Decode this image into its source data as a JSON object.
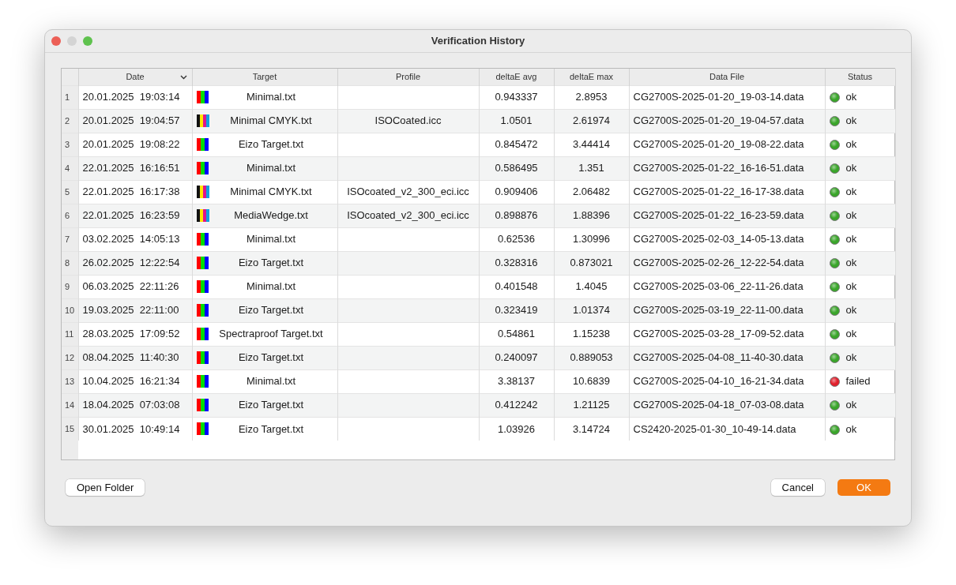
{
  "window": {
    "title": "Verification History"
  },
  "table": {
    "columns": [
      {
        "label": "Date",
        "sorted": true
      },
      {
        "label": "Target",
        "sorted": false
      },
      {
        "label": "Profile",
        "sorted": false
      },
      {
        "label": "deltaE avg",
        "sorted": false
      },
      {
        "label": "deltaE max",
        "sorted": false
      },
      {
        "label": "Data File",
        "sorted": false
      },
      {
        "label": "Status",
        "sorted": false
      }
    ],
    "rows": [
      {
        "index": "1",
        "date": "20.01.2025  19:03:14",
        "kind": "rgb",
        "target": "Minimal.txt",
        "profile": "",
        "avg": "0.943337",
        "max": "2.8953",
        "file": "CG2700S-2025-01-20_19-03-14.data",
        "color": "#3aa52a",
        "status": "ok"
      },
      {
        "index": "2",
        "date": "20.01.2025  19:04:57",
        "kind": "cmyk",
        "target": "Minimal CMYK.txt",
        "profile": "ISOCoated.icc",
        "avg": "1.0501",
        "max": "2.61974",
        "file": "CG2700S-2025-01-20_19-04-57.data",
        "color": "#3aa52a",
        "status": "ok"
      },
      {
        "index": "3",
        "date": "20.01.2025  19:08:22",
        "kind": "rgb",
        "target": "Eizo Target.txt",
        "profile": "",
        "avg": "0.845472",
        "max": "3.44414",
        "file": "CG2700S-2025-01-20_19-08-22.data",
        "color": "#3aa52a",
        "status": "ok"
      },
      {
        "index": "4",
        "date": "22.01.2025  16:16:51",
        "kind": "rgb",
        "target": "Minimal.txt",
        "profile": "",
        "avg": "0.586495",
        "max": "1.351",
        "file": "CG2700S-2025-01-22_16-16-51.data",
        "color": "#3aa52a",
        "status": "ok"
      },
      {
        "index": "5",
        "date": "22.01.2025  16:17:38",
        "kind": "cmyk",
        "target": "Minimal CMYK.txt",
        "profile": "ISOcoated_v2_300_eci.icc",
        "avg": "0.909406",
        "max": "2.06482",
        "file": "CG2700S-2025-01-22_16-17-38.data",
        "color": "#3aa52a",
        "status": "ok"
      },
      {
        "index": "6",
        "date": "22.01.2025  16:23:59",
        "kind": "cmyk",
        "target": "MediaWedge.txt",
        "profile": "ISOcoated_v2_300_eci.icc",
        "avg": "0.898876",
        "max": "1.88396",
        "file": "CG2700S-2025-01-22_16-23-59.data",
        "color": "#3aa52a",
        "status": "ok"
      },
      {
        "index": "7",
        "date": "03.02.2025  14:05:13",
        "kind": "rgb",
        "target": "Minimal.txt",
        "profile": "",
        "avg": "0.62536",
        "max": "1.30996",
        "file": "CG2700S-2025-02-03_14-05-13.data",
        "color": "#3aa52a",
        "status": "ok"
      },
      {
        "index": "8",
        "date": "26.02.2025  12:22:54",
        "kind": "rgb",
        "target": "Eizo Target.txt",
        "profile": "",
        "avg": "0.328316",
        "max": "0.873021",
        "file": "CG2700S-2025-02-26_12-22-54.data",
        "color": "#3aa52a",
        "status": "ok"
      },
      {
        "index": "9",
        "date": "06.03.2025  22:11:26",
        "kind": "rgb",
        "target": "Minimal.txt",
        "profile": "",
        "avg": "0.401548",
        "max": "1.4045",
        "file": "CG2700S-2025-03-06_22-11-26.data",
        "color": "#3aa52a",
        "status": "ok"
      },
      {
        "index": "10",
        "date": "19.03.2025  22:11:00",
        "kind": "rgb",
        "target": "Eizo Target.txt",
        "profile": "",
        "avg": "0.323419",
        "max": "1.01374",
        "file": "CG2700S-2025-03-19_22-11-00.data",
        "color": "#3aa52a",
        "status": "ok"
      },
      {
        "index": "11",
        "date": "28.03.2025  17:09:52",
        "kind": "rgb",
        "target": "Spectraproof Target.txt",
        "profile": "",
        "avg": "0.54861",
        "max": "1.15238",
        "file": "CG2700S-2025-03-28_17-09-52.data",
        "color": "#3aa52a",
        "status": "ok"
      },
      {
        "index": "12",
        "date": "08.04.2025  11:40:30",
        "kind": "rgb",
        "target": "Eizo Target.txt",
        "profile": "",
        "avg": "0.240097",
        "max": "0.889053",
        "file": "CG2700S-2025-04-08_11-40-30.data",
        "color": "#3aa52a",
        "status": "ok"
      },
      {
        "index": "13",
        "date": "10.04.2025  16:21:34",
        "kind": "rgb",
        "target": "Minimal.txt",
        "profile": "",
        "avg": "3.38137",
        "max": "10.6839",
        "file": "CG2700S-2025-04-10_16-21-34.data",
        "color": "#e0202c",
        "status": "failed"
      },
      {
        "index": "14",
        "date": "18.04.2025  07:03:08",
        "kind": "rgb",
        "target": "Eizo Target.txt",
        "profile": "",
        "avg": "0.412242",
        "max": "1.21125",
        "file": "CG2700S-2025-04-18_07-03-08.data",
        "color": "#3aa52a",
        "status": "ok"
      },
      {
        "index": "15",
        "date": "30.01.2025  10:49:14",
        "kind": "rgb",
        "target": "Eizo Target.txt",
        "profile": "",
        "avg": "1.03926",
        "max": "3.14724",
        "file": "CS2420-2025-01-30_10-49-14.data",
        "color": "#3aa52a",
        "status": "ok"
      }
    ]
  },
  "buttons": [
    {
      "label": "Open Folder",
      "kind": "plain"
    },
    {
      "label": "Cancel",
      "kind": "plain"
    },
    {
      "label": "OK",
      "kind": "default"
    }
  ]
}
